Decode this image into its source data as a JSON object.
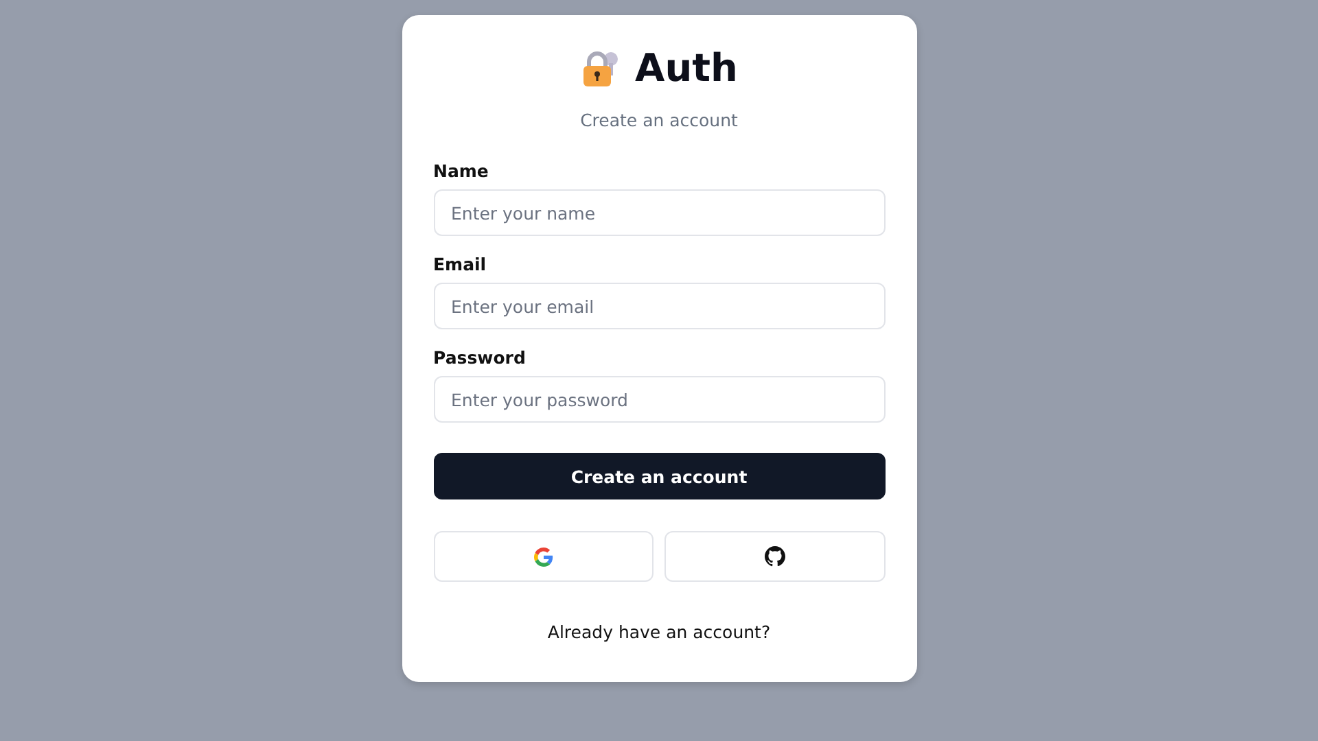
{
  "title": "Auth",
  "subtitle": "Create an account",
  "fields": [
    {
      "label": "Name",
      "placeholder": "Enter your name"
    },
    {
      "label": "Email",
      "placeholder": "Enter your email"
    },
    {
      "label": "Password",
      "placeholder": "Enter your password"
    }
  ],
  "submit": "Create an account",
  "social": [
    {
      "kind": "google"
    },
    {
      "kind": "github"
    }
  ],
  "footer_link": "Already have an account?"
}
